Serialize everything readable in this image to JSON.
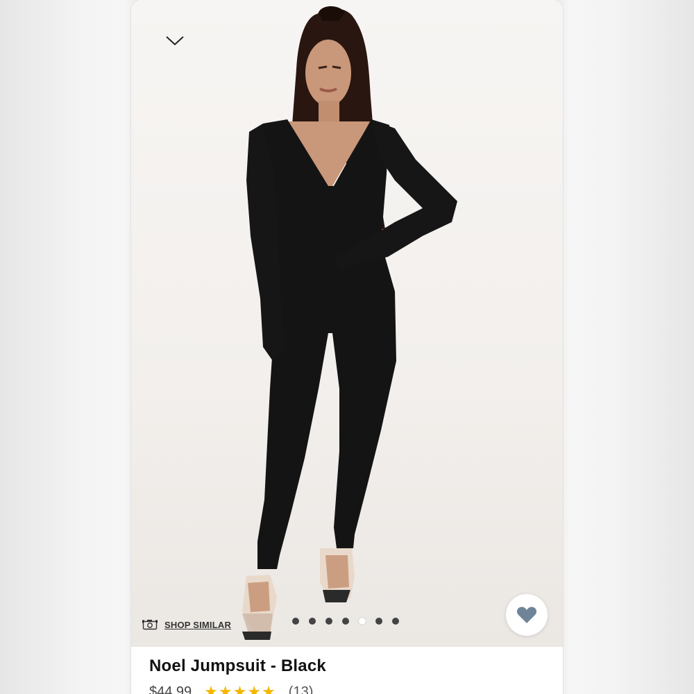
{
  "product": {
    "title": "Noel Jumpsuit - Black",
    "price": "$44.99",
    "rating_stars": "★★★★★",
    "rating_value": 4.5,
    "review_count": "(13)"
  },
  "gallery": {
    "shop_similar_label": "SHOP SIMILAR",
    "image_count": 7,
    "active_index": 4,
    "image_alt": "Model wearing black long-sleeve V-neck jumpsuit with clear heels"
  },
  "icons": {
    "collapse": "chevron-down-icon",
    "camera": "camera-icon",
    "favorite": "heart-icon"
  },
  "colors": {
    "heart": "#6f8597",
    "stars": "#f5b600",
    "dot": "#444444",
    "dot_active": "#ffffff"
  }
}
